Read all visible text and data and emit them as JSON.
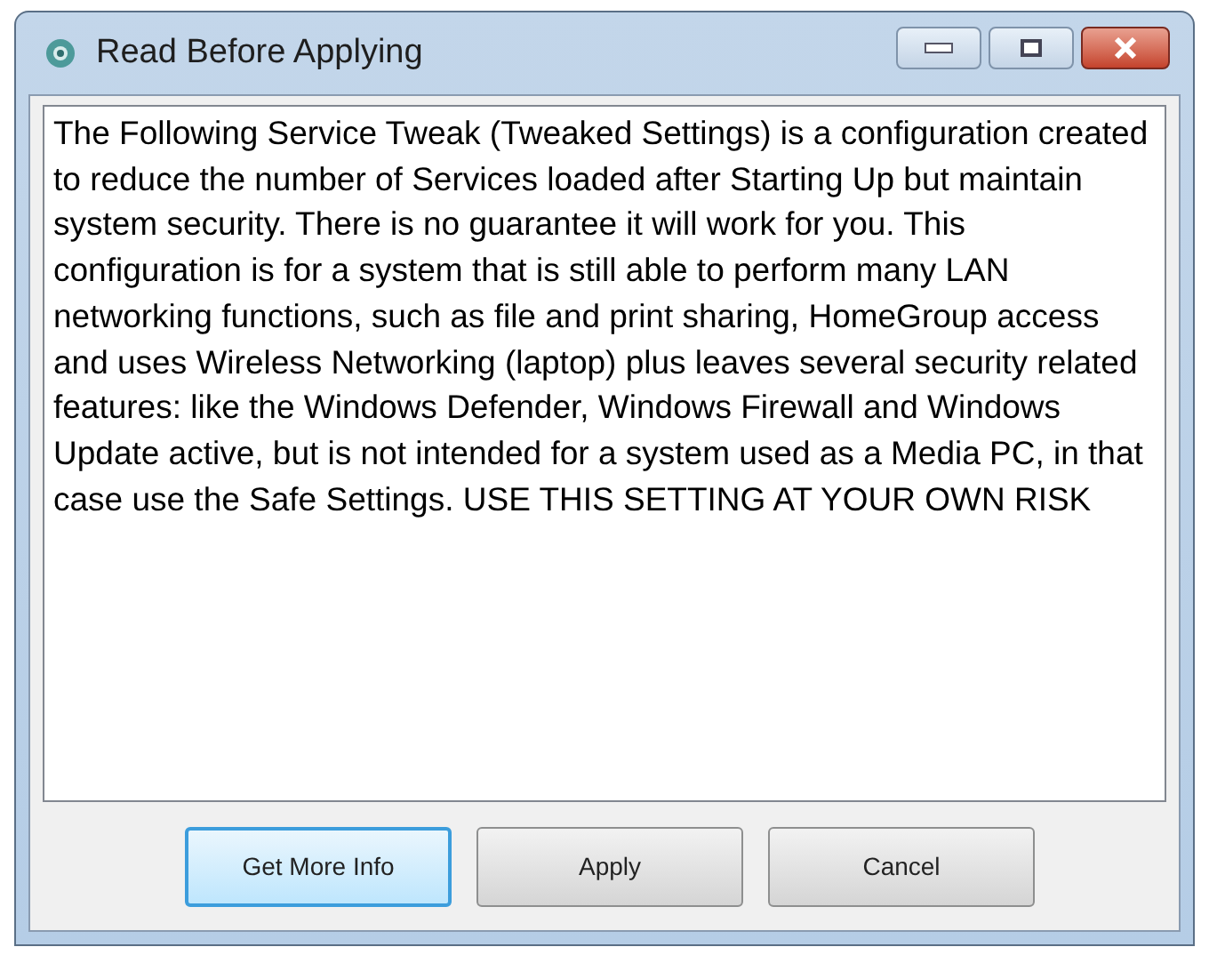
{
  "window": {
    "title": "Read Before Applying"
  },
  "message": "The Following Service Tweak (Tweaked Settings) is a configuration created to reduce the number of Services loaded after Starting Up but maintain system security. There is no guarantee it will work for you. This configuration is for a system that is still able to perform many LAN networking functions, such as file and print sharing, HomeGroup access and uses Wireless Networking (laptop) plus leaves several security related features: like the Windows Defender, Windows Firewall and Windows Update active, but is not intended for a system used as a Media PC, in that case use the Safe Settings. USE THIS SETTING AT YOUR OWN RISK",
  "buttons": [
    {
      "label": "Get More Info",
      "focused": true
    },
    {
      "label": "Apply",
      "focused": false
    },
    {
      "label": "Cancel",
      "focused": false
    }
  ]
}
